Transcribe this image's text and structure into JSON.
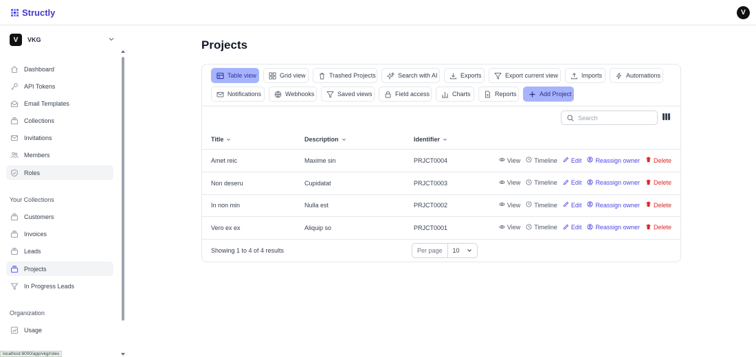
{
  "app": {
    "name": "Structly",
    "user_initial": "V"
  },
  "team": {
    "initial": "V",
    "name": "VKG"
  },
  "sidebar": {
    "items": [
      {
        "label": "Dashboard",
        "icon": "home-icon"
      },
      {
        "label": "API Tokens",
        "icon": "key-icon"
      },
      {
        "label": "Email Templates",
        "icon": "envelope-open-icon"
      },
      {
        "label": "Collections",
        "icon": "collection-icon"
      },
      {
        "label": "Invitations",
        "icon": "envelope-icon"
      },
      {
        "label": "Members",
        "icon": "users-icon"
      },
      {
        "label": "Roles",
        "icon": "shield-icon"
      }
    ],
    "collections_title": "Your Collections",
    "collections": [
      {
        "label": "Customers",
        "icon": "collection-icon"
      },
      {
        "label": "Invoices",
        "icon": "collection-icon"
      },
      {
        "label": "Leads",
        "icon": "collection-icon"
      },
      {
        "label": "Projects",
        "icon": "collection-icon"
      },
      {
        "label": "In Progress Leads",
        "icon": "filter-icon"
      }
    ],
    "org_title": "Organization",
    "org_items": [
      {
        "label": "Usage",
        "icon": "chart-icon"
      }
    ]
  },
  "status_url": "localhost:8000/app/vkg/roles",
  "page": {
    "title": "Projects"
  },
  "toolbar": {
    "table_view": "Table view",
    "grid_view": "Grid view",
    "trashed": "Trashed Projects",
    "search_ai": "Search with AI",
    "exports": "Exports",
    "export_current": "Export current view",
    "imports": "Imports",
    "automations": "Automations",
    "notifications": "Notifications",
    "webhooks": "Webhooks",
    "saved_views": "Saved views",
    "field_access": "Field access",
    "charts": "Charts",
    "reports": "Reports",
    "add_project": "Add Project"
  },
  "search": {
    "placeholder": "Search"
  },
  "table": {
    "columns": [
      "Title",
      "Description",
      "Identifier"
    ],
    "rows": [
      {
        "title": "Amet reic",
        "description": "Maxime sin",
        "identifier": "PRJCT0004"
      },
      {
        "title": "Non deseru",
        "description": "Cupidatat",
        "identifier": "PRJCT0003"
      },
      {
        "title": "In non min",
        "description": "Nulla est",
        "identifier": "PRJCT0002"
      },
      {
        "title": "Vero ex ex",
        "description": "Aliquip so",
        "identifier": "PRJCT0001"
      }
    ],
    "actions": {
      "view": "View",
      "timeline": "Timeline",
      "edit": "Edit",
      "reassign": "Reassign owner",
      "delete": "Delete"
    }
  },
  "footer": {
    "results": "Showing 1 to 4 of 4 results",
    "per_page_label": "Per page",
    "per_page_value": "10"
  },
  "colors": {
    "brand": "#4338ca",
    "accent": "#a5b4fc",
    "danger": "#dc2626"
  }
}
